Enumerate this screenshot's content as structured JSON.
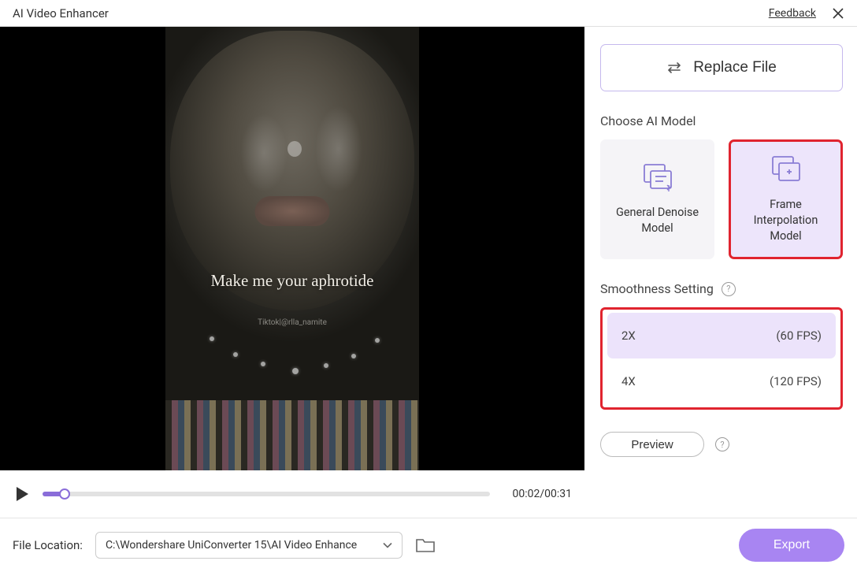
{
  "title": "AI Video Enhancer",
  "feedback": "Feedback",
  "replace_file": "Replace File",
  "choose_model_label": "Choose AI Model",
  "models": {
    "denoise": "General Denoise Model",
    "frame_interp": "Frame Interpolation Model"
  },
  "smoothness_label": "Smoothness Setting",
  "smoothness_options": {
    "opt1": {
      "mult": "2X",
      "fps": "(60 FPS)"
    },
    "opt2": {
      "mult": "4X",
      "fps": "(120 FPS)"
    }
  },
  "preview_label": "Preview",
  "file_location_label": "File Location:",
  "file_path": "C:\\Wondershare UniConverter 15\\AI Video Enhance",
  "export_label": "Export",
  "video": {
    "overlay1": "Make me your aphrotide",
    "overlay2": "Tiktok|@rlla_namite",
    "time": "00:02/00:31"
  }
}
